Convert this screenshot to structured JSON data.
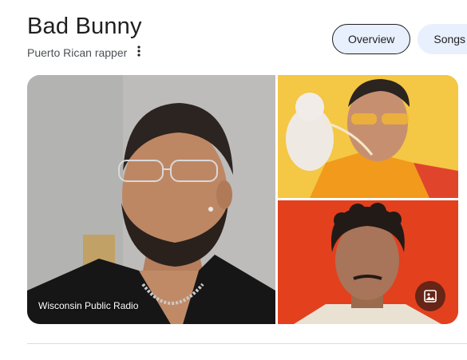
{
  "header": {
    "title": "Bad Bunny",
    "subtitle": "Puerto Rican rapper",
    "more_icon": "more-vertical-icon"
  },
  "tabs": [
    {
      "label": "Overview",
      "active": true
    },
    {
      "label": "Songs",
      "active": false
    }
  ],
  "gallery": {
    "main_image": {
      "source": "Wisconsin Public Radio",
      "icon": "person-photo"
    },
    "top_image": {
      "icon": "person-photo"
    },
    "bottom_image": {
      "icon": "person-photo",
      "button_icon": "image-icon"
    }
  },
  "colors": {
    "accent_tab_bg": "#e8f0fe",
    "divider": "#dadce0"
  }
}
